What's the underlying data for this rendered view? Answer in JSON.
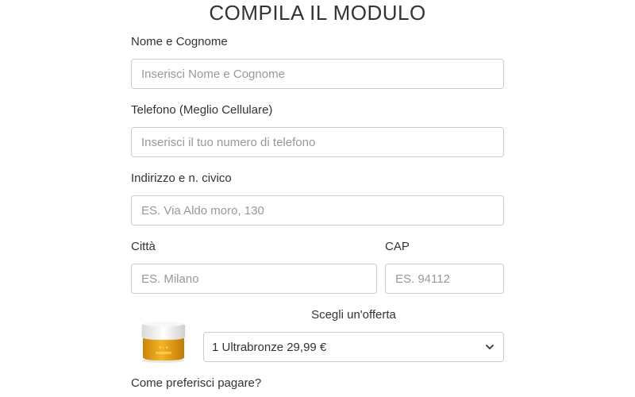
{
  "form": {
    "title": "COMPILA IL MODULO",
    "name": {
      "label": "Nome e Cognome",
      "placeholder": "Inserisci Nome e Cognome",
      "value": ""
    },
    "phone": {
      "label": "Telefono (Meglio Cellulare)",
      "placeholder": "Inserisci il tuo numero di telefono",
      "value": ""
    },
    "address": {
      "label": "Indirizzo e n. civico",
      "placeholder": "ES. Via Aldo moro, 130",
      "value": ""
    },
    "city": {
      "label": "Città",
      "placeholder": "ES. Milano",
      "value": ""
    },
    "cap": {
      "label": "CAP",
      "placeholder": "ES. 94112",
      "value": ""
    },
    "offer": {
      "label": "Scegli un'offerta",
      "selected": "1 Ultrabronze 29,99 €",
      "product_image": "cream-jar-product-image"
    },
    "payment": {
      "label": "Come preferisci pagare?"
    }
  },
  "colors": {
    "text": "#333333",
    "placeholder": "#999999",
    "border": "#cccccc",
    "jar_gold": "#e8a317",
    "jar_cap": "#f2f2f2"
  }
}
